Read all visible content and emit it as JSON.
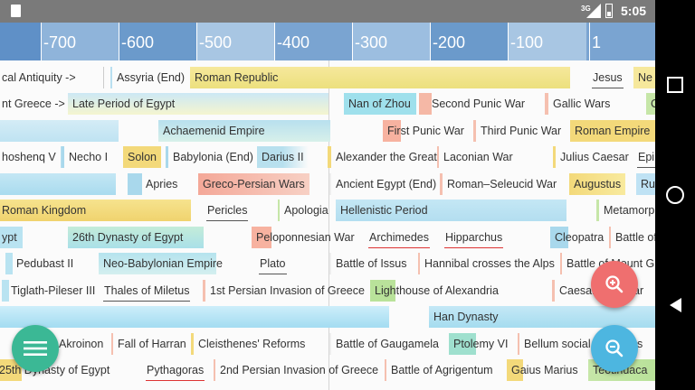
{
  "statusbar": {
    "network": "3G",
    "time": "5:05",
    "sd_icon": "sd-card-icon",
    "signal_icon": "signal-icon",
    "battery_icon": "battery-icon"
  },
  "axis": {
    "ticks": [
      "-700",
      "-600",
      "-500",
      "-400",
      "-300",
      "-200",
      "-100",
      "1"
    ],
    "colors": [
      "#6f9ccd",
      "#8db3d9",
      "#6f9ccd",
      "#a6c4e2",
      "#6f9ccd",
      "#8db3d9",
      "#6f9ccd",
      "#8db3d9"
    ]
  },
  "events": [
    "cal Antiquity ->",
    "Assyria (End)",
    "Roman Republic",
    "Jesus",
    "Ne",
    "nt Greece ->",
    "Late Period of Egypt",
    "Nan of Zhou",
    "Second Punic War",
    "Gallic Wars",
    "C",
    "Achaemenid Empire",
    "First Punic War",
    "Third Punic War",
    "Roman Empire",
    "hoshenq V",
    "Necho I",
    "Solon",
    "Babylonia (End)",
    "Darius II",
    "Alexander the Great",
    "Laconian War",
    "Julius Caesar",
    "Epi",
    "Apries",
    "Greco-Persian Wars",
    "Ancient Egypt (End)",
    "Roman–Seleucid War",
    "Augustus",
    "Ru",
    "Roman Kingdom",
    "Pericles",
    "Apologia",
    "Hellenistic Period",
    "Metamorp",
    "ypt",
    "26th Dynasty of Egypt",
    "Peloponnesian War",
    "Archimedes",
    "Hipparchus",
    "Cleopatra",
    "Battle of",
    "Pedubast II",
    "Neo-Babylonian Empire",
    "Plato",
    "Battle of Issus",
    "Hannibal crosses the Alps",
    "Battle of Mount G",
    "Tiglath-Pileser III",
    "Thales of Miletus",
    "1st Persian Invasion of Greece",
    "Lighthouse of Alexandria",
    "Caesar",
    "ar",
    "Han Dynasty",
    "Akroinon",
    "Fall of Harran",
    "Cleisthenes' Reforms",
    "Battle of Gaugamela",
    "Ptolemy VI",
    "Bellum social",
    "us",
    "25th Dynasty of Egypt",
    "Pythagoras",
    "2nd Persian Invasion of Greece",
    "Battle of Agrigentum",
    "Gaius Marius",
    "Teotihuaca"
  ],
  "fabs": {
    "zoom_in_icon": "zoom-in-icon",
    "zoom_out_icon": "zoom-out-icon",
    "menu_icon": "menu-icon",
    "zoom_in_color": "#ef6f6f",
    "zoom_out_color": "#4db6e0",
    "menu_color": "#3bb895"
  },
  "navbar": {
    "recent_icon": "recent-apps-icon",
    "home_icon": "home-icon",
    "back_icon": "back-icon"
  }
}
